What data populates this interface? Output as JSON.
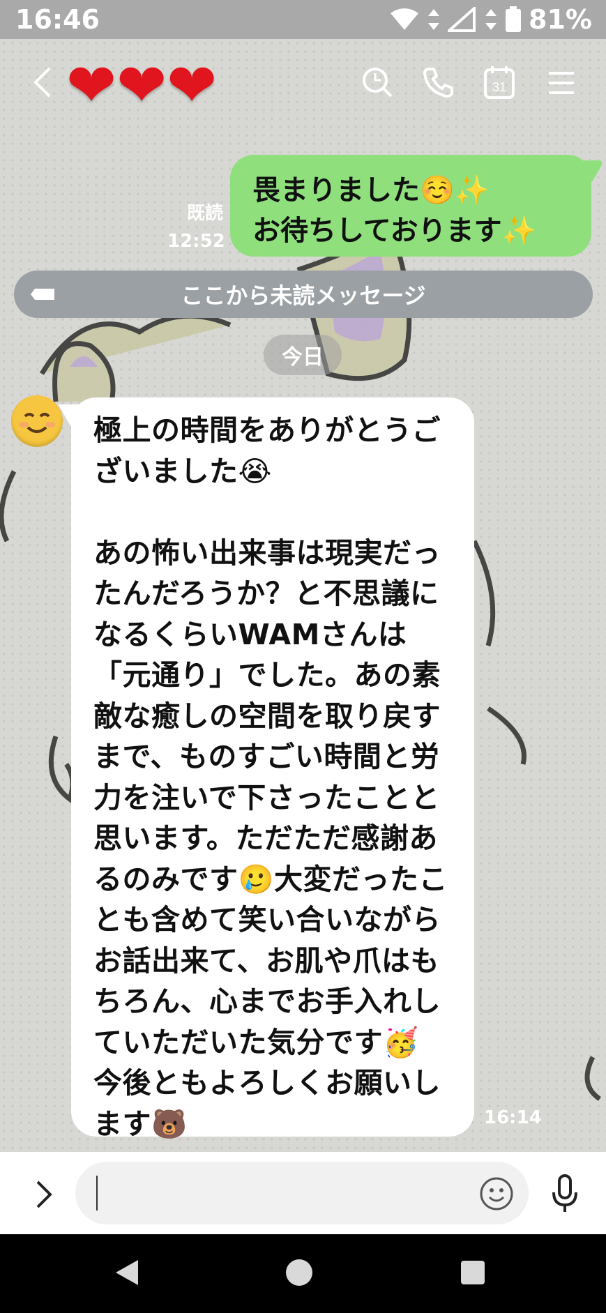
{
  "status_bar": {
    "time": "16:46",
    "battery": "81%"
  },
  "header": {
    "title_icon": "heart-icons",
    "actions": [
      "search-icon",
      "phone-icon",
      "calendar-icon",
      "menu-icon"
    ],
    "calendar_day": "31"
  },
  "messages": {
    "outgoing": {
      "lines": [
        "畏まりました☺️✨",
        "お待ちしております✨"
      ],
      "read_label": "既読",
      "time": "12:52"
    },
    "unread_divider": "ここから未読メッセージ",
    "date_divider": "今日",
    "incoming": {
      "sender_avatar": "smiling-face",
      "text": "極上の時間をありがとうございました😭\n\nあの怖い出来事は現実だったんだろうか？と不思議になるくらいWAMさんは「元通り」でした。あの素敵な癒しの空間を取り戻すまで、ものすごい時間と労力を注いで下さったことと思います。ただただ感謝あるのみです🥲大変だったことも含めて笑い合いながらお話出来て、お肌や爪はもちろん、心までお手入れしていただいた気分です🥳\n今後ともよろしくお願いします🐻",
      "time": "16:14"
    }
  },
  "input": {
    "expand_icon": "chevron-right-icon",
    "emoji_icon": "smiley-icon",
    "mic_icon": "microphone-icon"
  },
  "navigation": [
    "back-icon",
    "home-icon",
    "recents-icon"
  ]
}
